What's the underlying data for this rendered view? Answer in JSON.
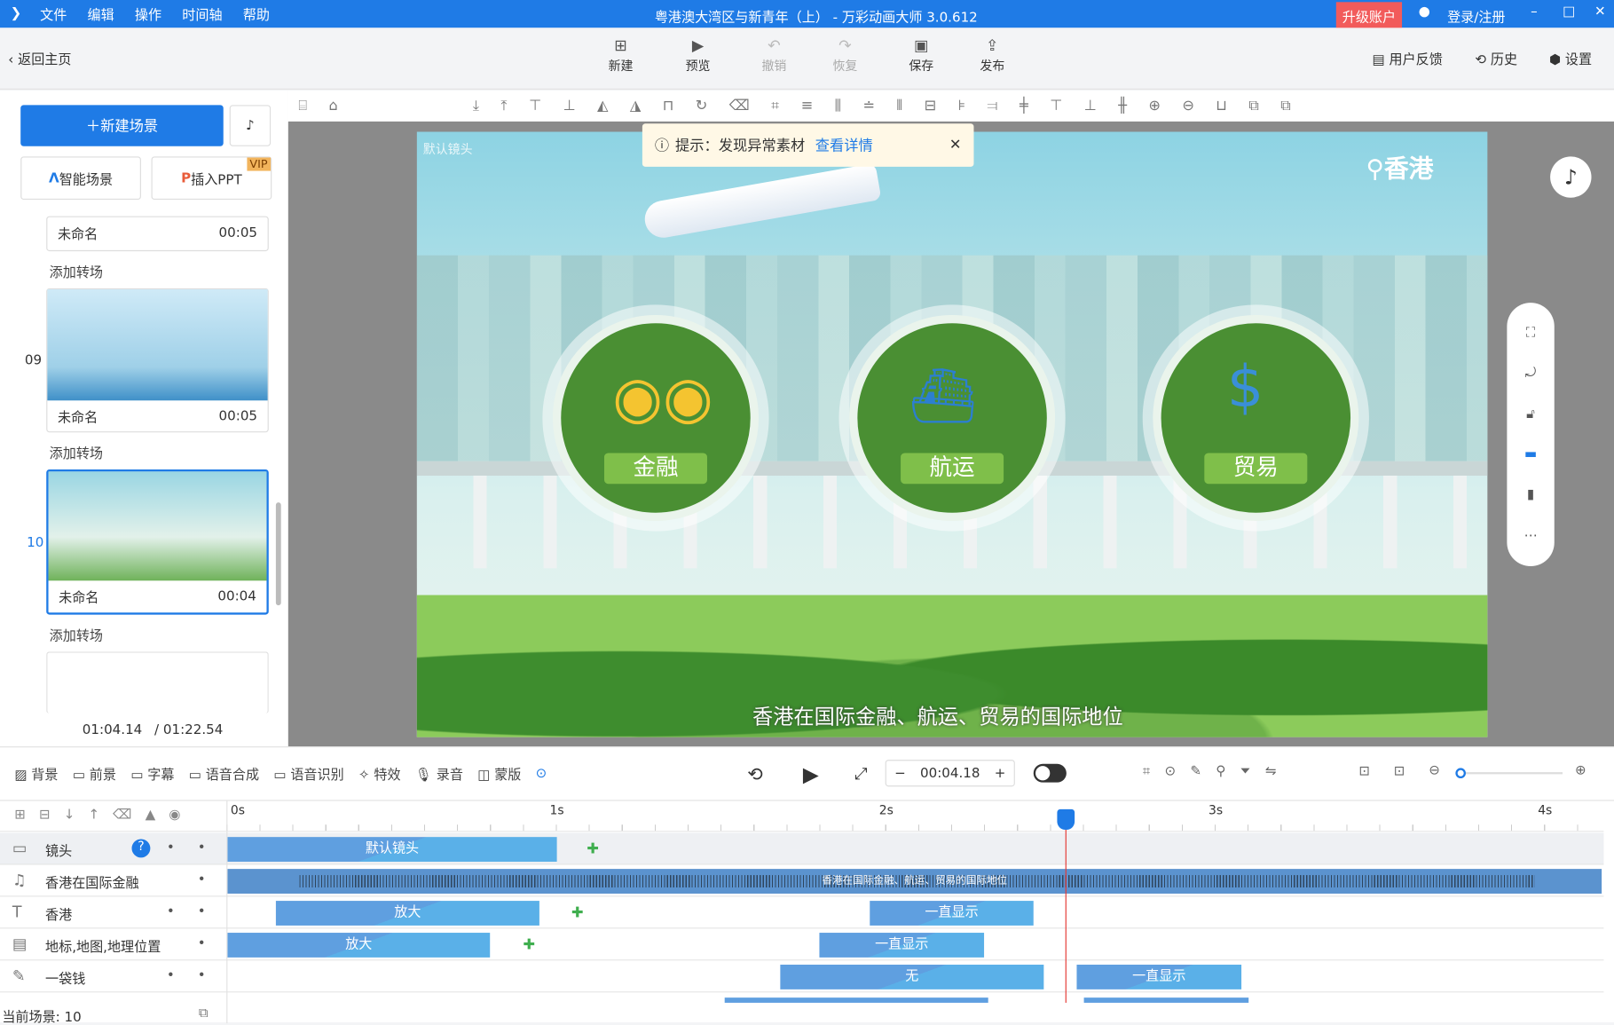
{
  "titlebar": {
    "menu": [
      "文件",
      "编辑",
      "操作",
      "时间轴",
      "帮助"
    ],
    "title": "粤港澳大湾区与新青年（上） - 万彩动画大师 3.0.612",
    "upgrade": "升级账户",
    "login": "登录/注册"
  },
  "toolbar": {
    "back": "返回主页",
    "buttons": [
      {
        "label": "新建",
        "icon": "plus-square-icon"
      },
      {
        "label": "预览",
        "icon": "play-icon"
      },
      {
        "label": "撤销",
        "icon": "undo-icon",
        "disabled": true
      },
      {
        "label": "恢复",
        "icon": "redo-icon",
        "disabled": true
      },
      {
        "label": "保存",
        "icon": "save-icon"
      },
      {
        "label": "发布",
        "icon": "publish-icon"
      }
    ],
    "feedback": "用户反馈",
    "history": "历史",
    "settings": "设置"
  },
  "left": {
    "new_scene": "新建场景",
    "smart_scene": "智能场景",
    "insert_ppt": "插入PPT",
    "vip": "VIP",
    "add_transition": "添加转场",
    "scenes": [
      {
        "name": "未命名",
        "duration": "00:05"
      },
      {
        "number": "09",
        "name": "未命名",
        "duration": "00:05"
      },
      {
        "number": "10",
        "name": "未命名",
        "duration": "00:04"
      }
    ],
    "current_time": "01:04.14",
    "total_time": "/ 01:22.54"
  },
  "stage": {
    "notice": "提示：发现异常素材",
    "notice_link": "查看详情",
    "camera_label": "默认镜头",
    "location": "香港",
    "circles": [
      "金融",
      "航运",
      "贸易"
    ],
    "subtitle": "香港在国际金融、航运、贸易的国际地位"
  },
  "timeline": {
    "tools": [
      "背景",
      "前景",
      "字幕",
      "语音合成",
      "语音识别",
      "特效",
      "录音",
      "蒙版"
    ],
    "time": "00:04.18",
    "ticks": [
      "0s",
      "1s",
      "2s",
      "3s",
      "4s"
    ],
    "tracks": [
      {
        "name": "镜头",
        "clips": [
          {
            "label": "默认镜头"
          }
        ]
      },
      {
        "name": "香港在国际金融",
        "clips": [
          {
            "label": "香港在国际金融、航运、贸易的国际地位"
          }
        ]
      },
      {
        "name": "香港",
        "clips": [
          {
            "label": "放大"
          },
          {
            "label": "一直显示"
          }
        ]
      },
      {
        "name": "地标,地图,地理位置",
        "clips": [
          {
            "label": "放大"
          },
          {
            "label": "一直显示"
          }
        ]
      },
      {
        "name": "一袋钱",
        "clips": [
          {
            "label": "无"
          },
          {
            "label": "一直显示"
          }
        ]
      }
    ],
    "status": "当前场景: 10"
  },
  "colors": {
    "accent": "#1f7be6",
    "upgrade": "#f25b5b",
    "clip": "#5f9fe0",
    "keyframe": "#3fae4e",
    "playhead": "#e53935"
  }
}
